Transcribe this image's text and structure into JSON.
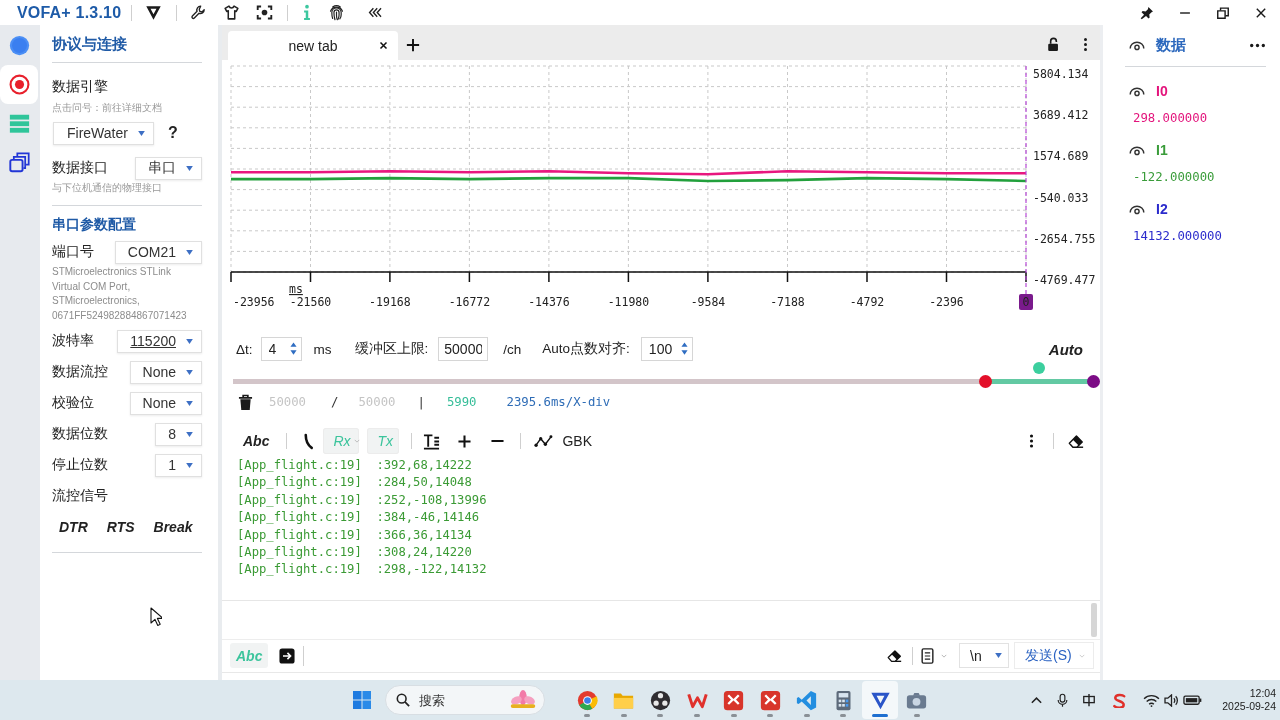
{
  "window": {
    "title": "VOFA+ 1.3.10"
  },
  "nav_rail": [
    {
      "kind": "circle",
      "selected": false
    },
    {
      "kind": "record",
      "selected": true
    },
    {
      "kind": "list",
      "selected": false
    },
    {
      "kind": "windows",
      "selected": false
    }
  ],
  "settings_panel": {
    "title": "协议与连接",
    "engine": {
      "label": "数据引擎",
      "hint": "点击问号：前往详细文档",
      "value": "FireWater",
      "help": "?"
    },
    "interface": {
      "label": "数据接口",
      "value": "串口",
      "hint": "与下位机通信的物理接口"
    },
    "serial_title": "串口参数配置",
    "port": {
      "label": "端口号",
      "value": "COM21",
      "description": "STMicroelectronics STLink Virtual COM Port, STMicroelectronics, 0671FF524982884867071423"
    },
    "params": [
      {
        "label": "波特率",
        "value": "115200",
        "kind": "editable"
      },
      {
        "label": "数据流控",
        "value": "None",
        "kind": "select"
      },
      {
        "label": "校验位",
        "value": "None",
        "kind": "select"
      },
      {
        "label": "数据位数",
        "value": "8",
        "kind": "select"
      },
      {
        "label": "停止位数",
        "value": "1",
        "kind": "select"
      }
    ],
    "signals_label": "流控信号",
    "signals": [
      "DTR",
      "RTS",
      "Break"
    ]
  },
  "tabs": [
    {
      "label": "new tab",
      "selected": true
    }
  ],
  "chart": {
    "chart_data": {
      "type": "line",
      "xlabel": "ms",
      "x": [
        -23956,
        -21560,
        -19168,
        -16772,
        -14376,
        -11980,
        -9584,
        -7188,
        -4792,
        -2396,
        0
      ],
      "series": [
        {
          "color": "#e8177f",
          "values": [
            350,
            350,
            400,
            350,
            400,
            300,
            250,
            400,
            350,
            300,
            300
          ]
        },
        {
          "color": "#22a03c",
          "values": [
            0,
            0,
            50,
            0,
            50,
            50,
            -100,
            -50,
            50,
            0,
            -100
          ]
        }
      ],
      "xlim": [
        -23956,
        0
      ],
      "ylim": [
        -4769.477,
        5804.134
      ],
      "xticks": [
        -23956,
        -21560,
        -19168,
        -16772,
        -14376,
        -11980,
        -9584,
        -7188,
        -4792,
        -2396,
        0
      ],
      "yticks": [
        5804.134,
        3689.412,
        1574.689,
        -540.033,
        -2654.755,
        -4769.477
      ],
      "grid": true
    }
  },
  "acquisition": {
    "dt_label": "Δt:",
    "dt_value": "4",
    "dt_unit": "ms",
    "buffer_label": "缓冲区上限:",
    "buffer_value": "50000",
    "buffer_unit": "/ch",
    "align_label": "Auto点数对齐:",
    "align_value": "100",
    "mode": "Auto"
  },
  "range_slider": {
    "handles": [
      {
        "level": 0.874,
        "color": "#e3102a"
      },
      {
        "level": 1,
        "color": "#7c0c86"
      }
    ]
  },
  "stats": {
    "received": "50000",
    "separator": "/",
    "capacity": "50000",
    "divider": "|",
    "points": "5990",
    "scale": "2395.6ms/X-div"
  },
  "terminal": {
    "format_label": "Abc",
    "rx": {
      "label": "Rx",
      "on": true
    },
    "tx": {
      "label": "Tx",
      "on": true
    },
    "encoding": "GBK",
    "lines": [
      "[App_flight.c:19]  :392,68,14222",
      "[App_flight.c:19]  :284,50,14048",
      "[App_flight.c:19]  :252,-108,13996",
      "[App_flight.c:19]  :384,-46,14146",
      "[App_flight.c:19]  :366,36,14134",
      "[App_flight.c:19]  :308,24,14220",
      "[App_flight.c:19]  :298,-122,14132"
    ]
  },
  "send_bar": {
    "format_label": "Abc",
    "line_ending": "\\n",
    "send_button": "发送(S)"
  },
  "data_panel": {
    "title": "数据",
    "channels": [
      {
        "name": "I0",
        "value": "298.000000",
        "color": "#e3147c",
        "visible": true
      },
      {
        "name": "I1",
        "value": "-122.000000",
        "color": "#3a9c3a",
        "visible": true
      },
      {
        "name": "I2",
        "value": "14132.000000",
        "color": "#2b2bcc",
        "visible": true
      }
    ]
  },
  "taskbar": {
    "search_placeholder": "搜索",
    "apps": [
      {
        "kind": "browser",
        "selected": false
      },
      {
        "kind": "folder",
        "selected": false
      },
      {
        "kind": "disc",
        "selected": false
      },
      {
        "kind": "zigzag",
        "selected": false
      },
      {
        "kind": "tile",
        "selected": false
      },
      {
        "kind": "tile",
        "selected": false
      },
      {
        "kind": "ribbon",
        "selected": false
      },
      {
        "kind": "calculator",
        "selected": false
      },
      {
        "kind": "vlogo",
        "selected": true
      },
      {
        "kind": "camera",
        "selected": false
      }
    ],
    "time": "12:04",
    "date": "2025-09-24"
  }
}
